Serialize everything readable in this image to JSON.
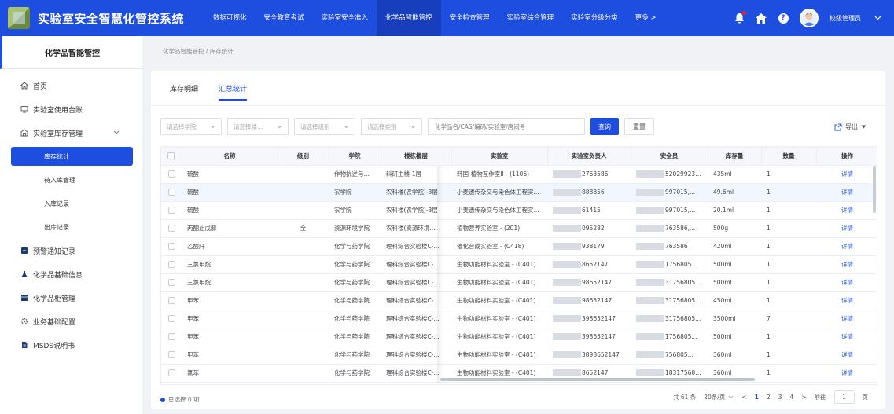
{
  "header": {
    "title": "实验室安全智慧化管控系统",
    "nav": [
      "数据可视化",
      "安全教育考试",
      "实验室安全准入",
      "化学品智能管控",
      "安全检查管理",
      "实验室综合管理",
      "实验室分级分类"
    ],
    "more": "更多 >",
    "user": "校级管理员"
  },
  "sidebar": {
    "title": "化学品智能管控",
    "items": [
      {
        "label": "首页",
        "icon": "home-icon"
      },
      {
        "label": "实验室使用台账",
        "icon": "monitor-icon"
      },
      {
        "label": "实验室库存管理",
        "icon": "warehouse-icon"
      }
    ],
    "sub_items": [
      "库存统计",
      "待入库管理",
      "入库记录",
      "出库记录"
    ],
    "items2": [
      {
        "label": "预警通知记录",
        "icon": "alert-icon"
      },
      {
        "label": "化学品基础信息",
        "icon": "flask-icon"
      },
      {
        "label": "化学品柜管理",
        "icon": "cabinet-icon"
      },
      {
        "label": "业务基础配置",
        "icon": "gear-icon"
      },
      {
        "label": "MSDS说明书",
        "icon": "document-icon"
      }
    ]
  },
  "breadcrumb": "化学品智能管控 / 库存统计",
  "tabs": [
    "库存明细",
    "汇总统计"
  ],
  "filters": {
    "college": "请选择学院",
    "building": "请选择楼...",
    "level": "请选择级别",
    "category": "请选择类别",
    "keyword_placeholder": "化学品名/CAS/编码/实验室/房间号",
    "query": "查询",
    "reset": "重置",
    "export": "导出"
  },
  "table": {
    "headers": [
      "名称",
      "级别",
      "学院",
      "楼栋楼层",
      "实验室",
      "实验室负责人",
      "安全员",
      "库存量",
      "数量",
      "操作"
    ],
    "rows": [
      [
        "硫酸",
        "",
        "作物抗逆与高...",
        "科研主楼-1层",
        "韩国-植物互作室II - (1106)",
        "2763586",
        "5202992393",
        "435ml",
        "1",
        "详情"
      ],
      [
        "硫酸",
        "",
        "农学院",
        "农科楼(农学院)-3层",
        "小麦遗传杂交与染色体工程实...",
        "888856",
        "997015,...",
        "49.6ml",
        "1",
        "详情"
      ],
      [
        "硫酸",
        "",
        "农学院",
        "农科楼(农学院)-3层",
        "小麦遗传杂交与染色体工程实...",
        "61415",
        "997015,...",
        "20.1ml",
        "1",
        "详情"
      ],
      [
        "丙酮止戊醇",
        "全",
        "资源环境学院",
        "农科楼(资源环境...",
        "植物营养实验室 - (201)",
        "095282",
        "763586,...",
        "500g",
        "1",
        "详情"
      ],
      [
        "乙酸肝",
        "",
        "化学与药学院",
        "理科综合实验楼C-...",
        "催化合成实验室 - (C418)",
        "938179",
        "763586",
        "420ml",
        "1",
        "详情"
      ],
      [
        "三氯甲烷",
        "",
        "化学与药学院",
        "理科综合实验楼C-...",
        "生物功能材料实验室 - (C401)",
        "8652147",
        "1756805...",
        "500ml",
        "1",
        "详情"
      ],
      [
        "三氯甲烷",
        "",
        "化学与药学院",
        "理科综合实验楼C-...",
        "生物功能材料实验室 - (C401)",
        "98652147",
        "31756805...",
        "500ml",
        "1",
        "详情"
      ],
      [
        "甲苯",
        "",
        "化学与药学院",
        "理科综合实验楼C-...",
        "生物功能材料实验室 - (C401)",
        "98652147",
        "31756805...",
        "450ml",
        "1",
        "详情"
      ],
      [
        "甲苯",
        "",
        "化学与药学院",
        "理科综合实验楼C-...",
        "生物功能材料实验室 - (C401)",
        "398652147",
        "31756805...",
        "3500ml",
        "7",
        "详情"
      ],
      [
        "甲苯",
        "",
        "化学与药学院",
        "理科综合实验楼C-...",
        "生物功能材料实验室 - (C401)",
        "398652147",
        "1756805...",
        "500ml",
        "1",
        "详情"
      ],
      [
        "甲苯",
        "",
        "化学与药学院",
        "理科综合实验楼C-...",
        "生物功能材料实验室 - (C401)",
        "3898652147",
        "756805...",
        "360ml",
        "1",
        "详情"
      ],
      [
        "氯苯",
        "",
        "化学与药学院",
        "理科综合实验楼C-...",
        "生物功能材料实验室 - (C401)",
        "8652147",
        "1831756805...",
        "360ml",
        "1",
        "详情"
      ]
    ]
  },
  "footer": {
    "selected": "已选择 0 项",
    "total": "共 61 条",
    "page_size": "20条/页",
    "pages": [
      "1",
      "2",
      "3",
      "4"
    ],
    "current_page": "1",
    "goto": "前往",
    "page_input": "1",
    "page_unit": "页"
  },
  "colors": {
    "primary": "#1d4ee0",
    "active_nav": "#173fbd"
  }
}
